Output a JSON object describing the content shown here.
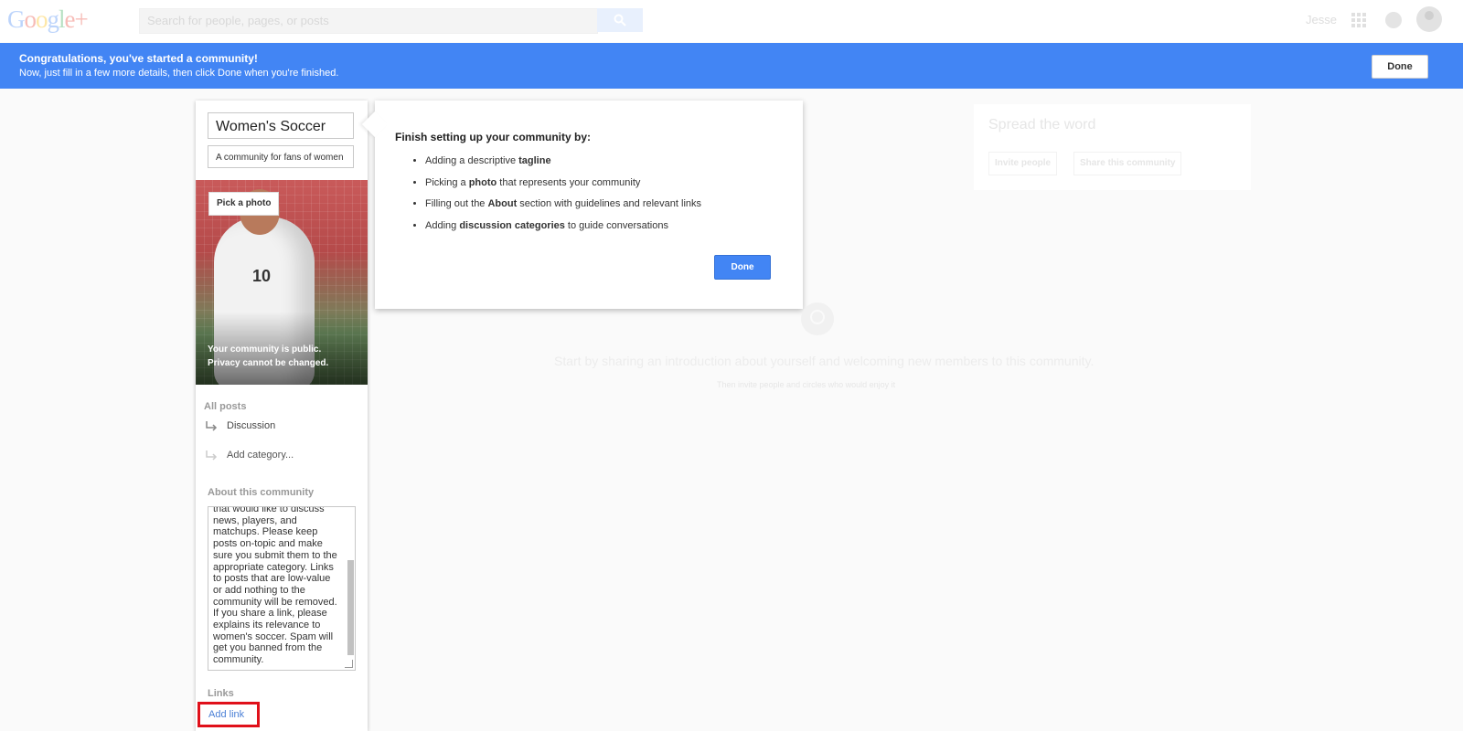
{
  "header": {
    "logo": {
      "google": "Google",
      "plus": "+"
    },
    "search_placeholder": "Search for people, pages, or posts",
    "user_name": "Jesse",
    "icons": [
      "search-icon",
      "apps-grid-icon",
      "notifications-icon",
      "avatar"
    ]
  },
  "banner": {
    "title": "Congratulations, you've started a community!",
    "subtitle": "Now, just fill in a few more details, then click Done when you're finished.",
    "done_label": "Done",
    "color": "#4285f4"
  },
  "community": {
    "name": "Women's Soccer",
    "tagline": "A community for fans of women",
    "pick_photo_label": "Pick a photo",
    "privacy_line1": "Your community is public.",
    "privacy_line2": "Privacy cannot be changed.",
    "all_posts_label": "All posts",
    "categories": [
      "Discussion"
    ],
    "add_category_label": "Add category...",
    "about_label": "About this community",
    "about_text": "that would like to discuss\nnews, players, and\nmatchups. Please keep\nposts on-topic and make\nsure you submit them to the\nappropriate category. Links\nto posts that are low-value\nor add nothing to the\ncommunity will be removed.\nIf you share a link, please\nexplains its relevance to\nwomen's soccer. Spam will\nget you banned from the\ncommunity.",
    "links_label": "Links",
    "add_link_label": "Add link",
    "highlight_color": "#e0101a"
  },
  "popup": {
    "heading": "Finish setting up your community by:",
    "items": [
      {
        "before": "Adding a descriptive ",
        "bold": "tagline",
        "after": ""
      },
      {
        "before": "Picking a ",
        "bold": "photo",
        "after": " that represents your community"
      },
      {
        "before": "Filling out the ",
        "bold": "About",
        "after": " section with guidelines and relevant links"
      },
      {
        "before": "Adding ",
        "bold": "discussion categories",
        "after": " to guide conversations"
      }
    ],
    "done_label": "Done"
  },
  "spread": {
    "title": "Spread the word",
    "invite_label": "Invite people",
    "share_label": "Share this community"
  },
  "empty_state": {
    "line1": "Start by sharing an introduction about yourself and welcoming new members to this community.",
    "line2": "Then invite people and circles who would enjoy it"
  }
}
